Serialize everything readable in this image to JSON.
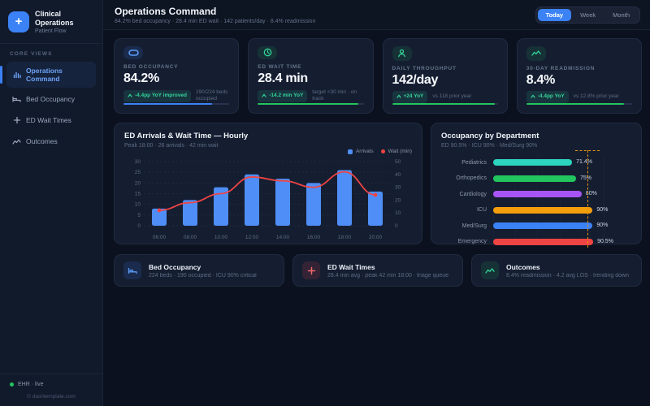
{
  "sidebar": {
    "title": "Clinical Operations",
    "subtitle": "Patient Flow",
    "section_label": "CORE VIEWS",
    "items": [
      {
        "label": "Operations Command",
        "icon": "bar-chart-icon",
        "active": true
      },
      {
        "label": "Bed Occupancy",
        "icon": "bed-icon",
        "active": false
      },
      {
        "label": "ED Wait Times",
        "icon": "plus-icon",
        "active": false
      },
      {
        "label": "Outcomes",
        "icon": "trend-icon",
        "active": false
      }
    ],
    "footer": {
      "status": "EHR · live",
      "copyright": "© dashtemplate.com"
    }
  },
  "header": {
    "title": "Operations Command",
    "subtitle": "84.2% bed occupancy · 28.4 min ED wait · 142 patients/day · 8.4% readmission",
    "range": [
      {
        "label": "Today",
        "active": true
      },
      {
        "label": "Week",
        "active": false
      },
      {
        "label": "Month",
        "active": false
      }
    ]
  },
  "kpis": [
    {
      "label": "BED OCCUPANCY",
      "value": "84.2%",
      "badge": "-4.4pp YoY improved",
      "note": "190/224 beds occupied",
      "icon": "bed-icon",
      "progress_pct": 84,
      "accent_color": "#3b82f6"
    },
    {
      "label": "ED WAIT TIME",
      "value": "28.4 min",
      "badge": "-14.2 min YoY",
      "note": "target <30 min · on track",
      "icon": "clock-icon",
      "progress_pct": 95,
      "accent_color": "#22c55e"
    },
    {
      "label": "DAILY THROUGHPUT",
      "value": "142/day",
      "badge": "+24 YoY",
      "note": "vs 118 prior year",
      "icon": "person-icon",
      "progress_pct": 97,
      "accent_color": "#22c55e"
    },
    {
      "label": "30-DAY READMISSION",
      "value": "8.4%",
      "badge": "-4.4pp YoY",
      "note": "vs 12.8% prior year",
      "icon": "trend-icon",
      "progress_pct": 92,
      "accent_color": "#22c55e"
    }
  ],
  "chart_data": [
    {
      "type": "bar+line",
      "title": "ED Arrivals & Wait Time — Hourly",
      "subtitle": "Peak 18:00 · 26 arrivals · 42 min wait",
      "categories": [
        "06:00",
        "08:00",
        "10:00",
        "12:00",
        "14:00",
        "16:00",
        "18:00",
        "20:00"
      ],
      "series": [
        {
          "name": "Arrivals",
          "type": "bar",
          "axis": "left",
          "color": "#4f8ef7",
          "values": [
            8,
            12,
            18,
            24,
            22,
            20,
            26,
            16
          ]
        },
        {
          "name": "Wait (min)",
          "type": "line",
          "axis": "right",
          "color": "#ef4444",
          "values": [
            12,
            18,
            25,
            38,
            35,
            30,
            42,
            24
          ]
        }
      ],
      "left_axis": {
        "min": 0,
        "max": 30,
        "ticks": [
          0,
          5,
          10,
          15,
          20,
          25,
          30
        ]
      },
      "right_axis": {
        "min": 0,
        "max": 50,
        "ticks": [
          0,
          10,
          20,
          30,
          40,
          50
        ]
      },
      "legend_position": "top-right",
      "grid": true
    },
    {
      "type": "bar-horizontal",
      "title": "Occupancy by Department",
      "subtitle": "ED 90.5% · ICU 90% · Med/Surg 90%",
      "categories": [
        "Pediatrics",
        "Orthopedics",
        "Cardiology",
        "ICU",
        "Med/Surg",
        "Emergency"
      ],
      "values": [
        71.4,
        75,
        80,
        90,
        90,
        90.5
      ],
      "value_labels": [
        "71.4%",
        "75%",
        "80%",
        "90%",
        "90%",
        "90.5%"
      ],
      "colors": [
        "#2dd4bf",
        "#22c55e",
        "#a855f7",
        "#f59e0b",
        "#3b82f6",
        "#ef4444"
      ],
      "xlim": [
        0,
        100
      ],
      "grid_ticks": [
        0,
        20,
        40,
        60,
        80,
        100
      ],
      "threshold": 85,
      "threshold_color": "#e8920c"
    }
  ],
  "summary_cards": [
    {
      "title": "Bed Occupancy",
      "subtitle": "224 beds · 190 occupied · ICU 90% critical",
      "icon": "bed-icon"
    },
    {
      "title": "ED Wait Times",
      "subtitle": "28.4 min avg · peak 42 min 18:00 · triage queue",
      "icon": "plus-icon"
    },
    {
      "title": "Outcomes",
      "subtitle": "8.4% readmission · 4.2 avg LOS · trending down",
      "icon": "trend-icon"
    }
  ]
}
